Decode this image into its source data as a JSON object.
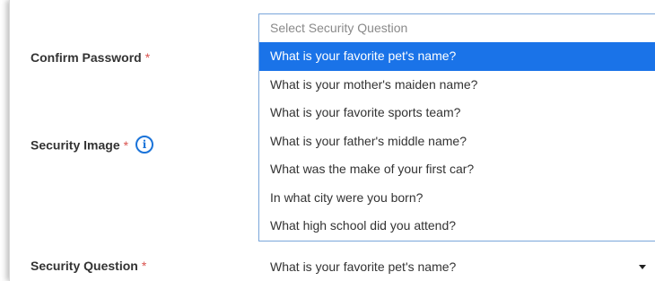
{
  "fields": {
    "confirm_password": {
      "label": "Confirm Password",
      "required": "*"
    },
    "security_image": {
      "label": "Security Image",
      "required": "*",
      "info_icon": "info-icon"
    },
    "security_question": {
      "label": "Security Question",
      "required": "*"
    }
  },
  "dropdown": {
    "placeholder": "Select Security Question",
    "options": [
      "What is your favorite pet's name?",
      "What is your mother's maiden name?",
      "What is your favorite sports team?",
      "What is your father's middle name?",
      "What was the make of your first car?",
      "In what city were you born?",
      "What high school did you attend?"
    ],
    "highlighted_index": 0
  },
  "select": {
    "value": "What is your favorite pet's name?"
  },
  "colors": {
    "highlight": "#1a73e8",
    "required": "#d9534f",
    "info": "#1a73d9"
  }
}
